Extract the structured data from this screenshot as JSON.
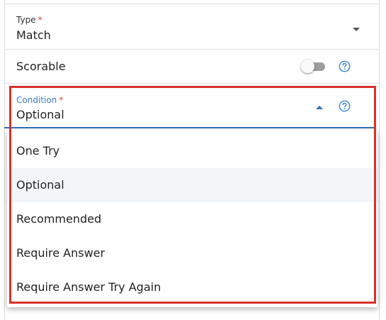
{
  "type_field": {
    "label": "Type",
    "required_marker": "*",
    "value": "Match"
  },
  "scorable": {
    "label": "Scorable",
    "enabled": false
  },
  "condition_field": {
    "label": "Condition",
    "required_marker": "*",
    "value": "Optional",
    "options": [
      "One Try",
      "Optional",
      "Recommended",
      "Require Answer",
      "Require Answer Try Again"
    ],
    "selected_index": 1
  },
  "colors": {
    "accent": "#2f6fbd",
    "required": "#e03a3a",
    "highlight_border": "#d8322b",
    "toggle_track": "#9e9e9e"
  },
  "icons": {
    "type_dropdown": "chevron-down-icon",
    "condition_dropdown": "chevron-up-icon",
    "help": "help-circle-icon"
  }
}
